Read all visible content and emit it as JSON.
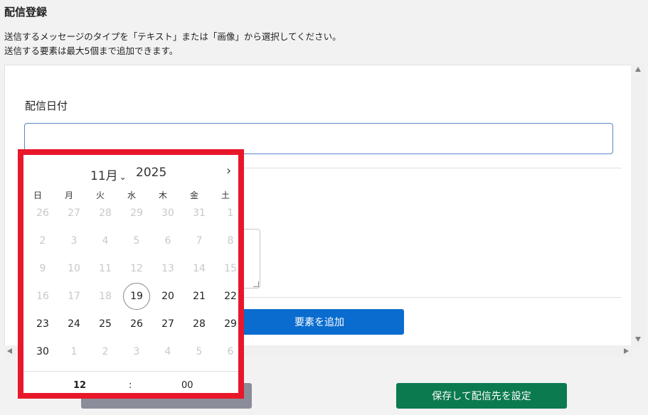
{
  "page": {
    "title": "配信登録",
    "desc_line1": "送信するメッセージのタイプを「テキスト」または「画像」から選択してください。",
    "desc_line2": "送信する要素は最大5個まで追加できます。"
  },
  "form": {
    "date_label": "配信日付",
    "date_value": "",
    "add_element_button": "要素を追加"
  },
  "footer": {
    "left_button": "",
    "save_button": "保存して配信先を設定"
  },
  "datepicker": {
    "month": "11月",
    "year": "2025",
    "weekdays": [
      "日",
      "月",
      "火",
      "水",
      "木",
      "金",
      "土"
    ],
    "weeks": [
      [
        "26",
        "27",
        "28",
        "29",
        "30",
        "31",
        "1"
      ],
      [
        "2",
        "3",
        "4",
        "5",
        "6",
        "7",
        "8"
      ],
      [
        "9",
        "10",
        "11",
        "12",
        "13",
        "14",
        "15"
      ],
      [
        "16",
        "17",
        "18",
        "19",
        "20",
        "21",
        "22"
      ],
      [
        "23",
        "24",
        "25",
        "26",
        "27",
        "28",
        "29"
      ],
      [
        "30",
        "1",
        "2",
        "3",
        "4",
        "5",
        "6"
      ]
    ],
    "disabled_until_index": 24,
    "today": "19",
    "time_hour": "12",
    "time_sep": ":",
    "time_minute": "00"
  },
  "colors": {
    "highlight_border": "#e8172a",
    "primary_blue": "#0a6ccf",
    "save_green": "#0b7a4f",
    "gray_button": "#8a8d99"
  },
  "icons": {
    "month_dropdown": "chevron-down-icon",
    "next_month": "chevron-right-icon"
  }
}
